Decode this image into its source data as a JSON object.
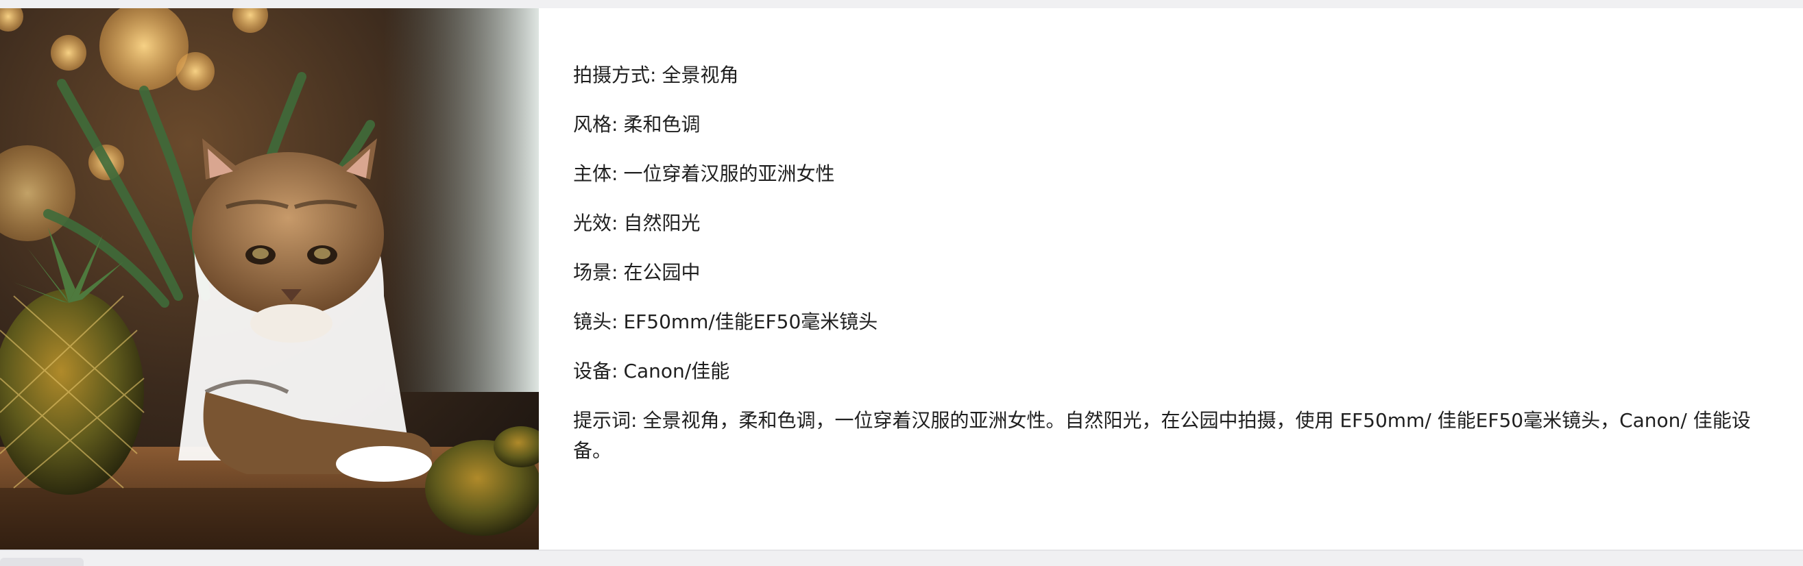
{
  "image": {
    "alt_icon": "image-thumbnail",
    "subject": "tabby cat with pineapple"
  },
  "details": [
    {
      "label": "拍摄方式",
      "value": "全景视角"
    },
    {
      "label": "风格",
      "value": "柔和色调"
    },
    {
      "label": "主体",
      "value": "一位穿着汉服的亚洲女性"
    },
    {
      "label": "光效",
      "value": "自然阳光"
    },
    {
      "label": "场景",
      "value": "在公园中"
    },
    {
      "label": "镜头",
      "value": "EF50mm/佳能EF50毫米镜头"
    },
    {
      "label": "设备",
      "value": "Canon/佳能"
    }
  ],
  "prompt": {
    "label": "提示词",
    "value": "全景视角，柔和色调，一位穿着汉服的亚洲女性。自然阳光，在公园中拍摄，使用 EF50mm/ 佳能EF50毫米镜头，Canon/ 佳能设备。"
  },
  "colors": {
    "text": "#1f1f1f",
    "card": "#ffffff",
    "page": "#f0f0f2"
  }
}
